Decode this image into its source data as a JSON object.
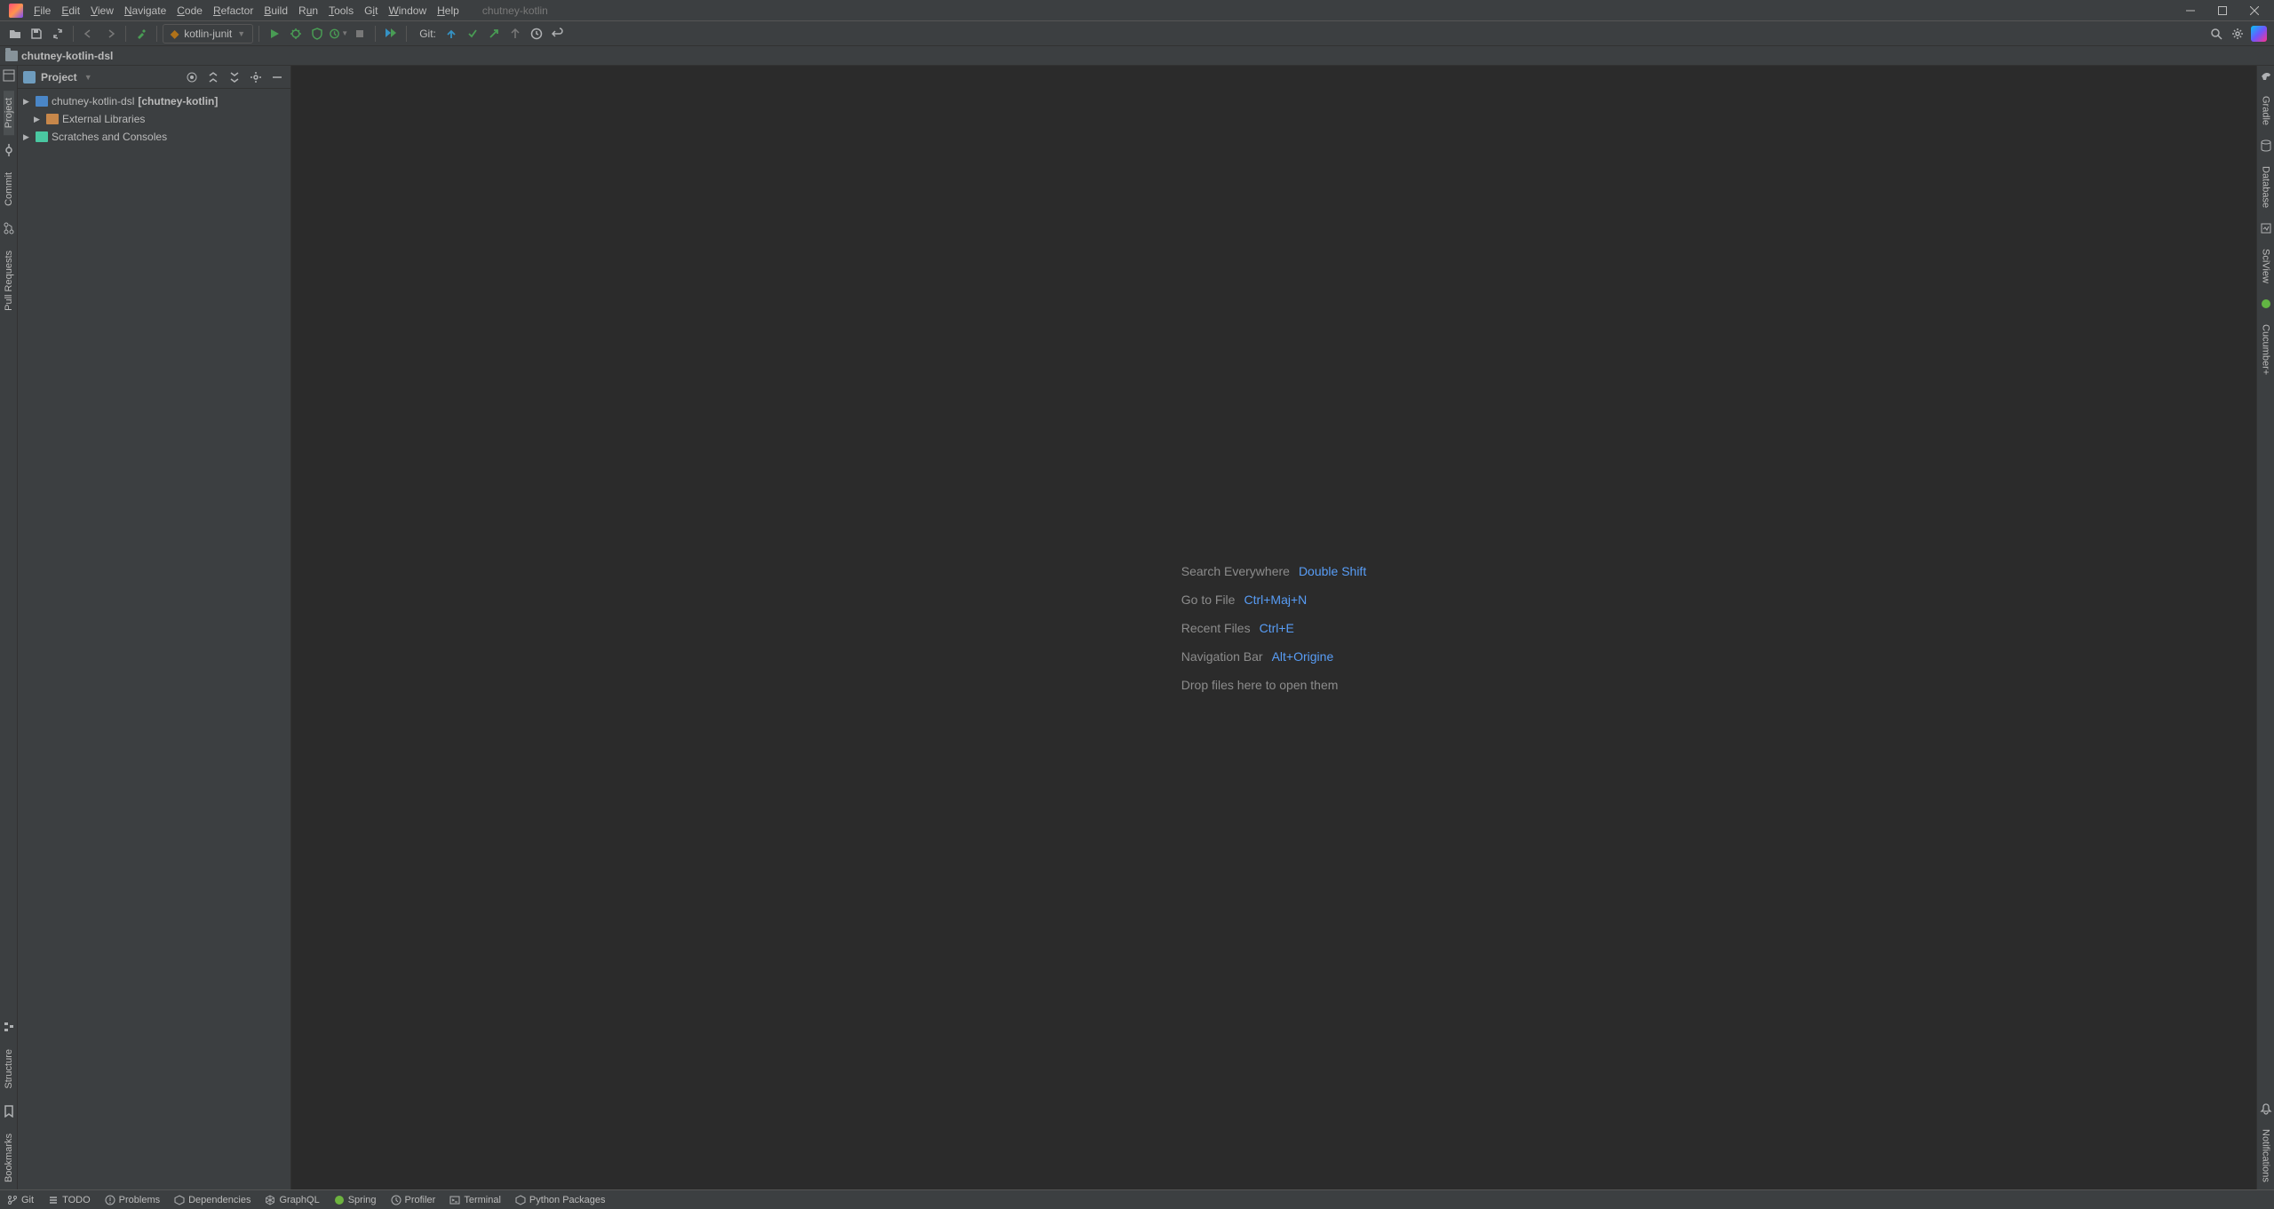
{
  "window": {
    "project_title": "chutney-kotlin"
  },
  "menu": {
    "file": "File",
    "edit": "Edit",
    "view": "View",
    "navigate": "Navigate",
    "code": "Code",
    "refactor": "Refactor",
    "build": "Build",
    "run": "Run",
    "tools": "Tools",
    "git": "Git",
    "window": "Window",
    "help": "Help"
  },
  "toolbar": {
    "run_config_label": "kotlin-junit",
    "git_label": "Git:"
  },
  "navbar": {
    "crumb1": "chutney-kotlin-dsl"
  },
  "left_tabs": {
    "project": "Project",
    "commit": "Commit",
    "pull_requests": "Pull Requests",
    "structure": "Structure",
    "bookmarks": "Bookmarks"
  },
  "right_tabs": {
    "gradle": "Gradle",
    "database": "Database",
    "sciview": "SciView",
    "cucumber": "Cucumber+",
    "notifications": "Notifications"
  },
  "project_panel": {
    "title": "Project"
  },
  "tree": {
    "root_name": "chutney-kotlin-dsl",
    "root_context": "[chutney-kotlin]",
    "ext_libs": "External Libraries",
    "scratches": "Scratches and Consoles"
  },
  "welcome": {
    "search_label": "Search Everywhere",
    "search_key": "Double Shift",
    "goto_label": "Go to File",
    "goto_key": "Ctrl+Maj+N",
    "recent_label": "Recent Files",
    "recent_key": "Ctrl+E",
    "nav_label": "Navigation Bar",
    "nav_key": "Alt+Origine",
    "drop": "Drop files here to open them"
  },
  "bottombar": {
    "git": "Git",
    "todo": "TODO",
    "problems": "Problems",
    "dependencies": "Dependencies",
    "graphql": "GraphQL",
    "spring": "Spring",
    "profiler": "Profiler",
    "terminal": "Terminal",
    "python": "Python Packages"
  }
}
